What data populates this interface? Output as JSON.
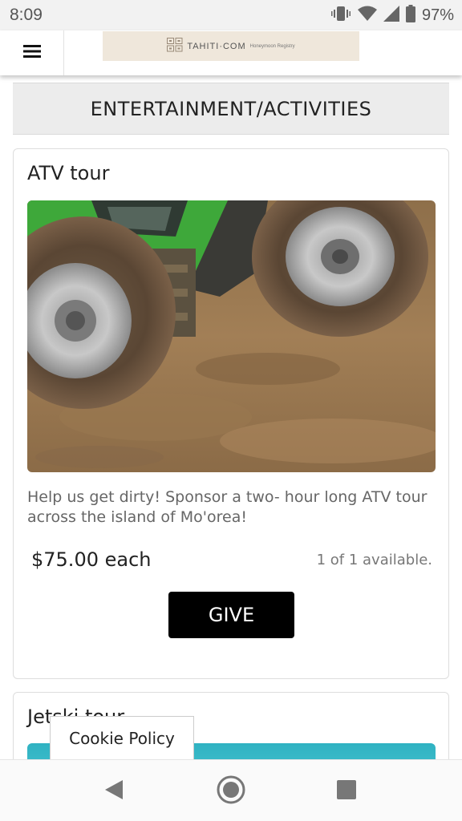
{
  "status_bar": {
    "time": "8:09",
    "battery_percent": "97%",
    "icons": [
      "vibrate-icon",
      "wifi-icon",
      "signal-icon",
      "battery-icon"
    ]
  },
  "header": {
    "menu_icon": "hamburger-menu-icon",
    "logo": {
      "brand": "TAHITI·COM",
      "tagline": "Honeymoon Registry"
    }
  },
  "section": {
    "title": "ENTERTAINMENT/ACTIVITIES"
  },
  "items": [
    {
      "title": "ATV tour",
      "description": "Help us get dirty! Sponsor a two- hour long ATV tour across the island of Mo'orea!",
      "price": "$75.00 each",
      "availability": "1 of 1 available.",
      "button_label": "GIVE"
    },
    {
      "title": "Jetski tour"
    }
  ],
  "cookie_policy": {
    "label": "Cookie Policy"
  },
  "nav_bar": {
    "icons": [
      "back-icon",
      "home-icon",
      "recents-icon"
    ]
  },
  "colors": {
    "button_bg": "#000000",
    "section_bg": "#ececec",
    "logo_bg": "#efe7db",
    "water": "#3ab9c7"
  }
}
